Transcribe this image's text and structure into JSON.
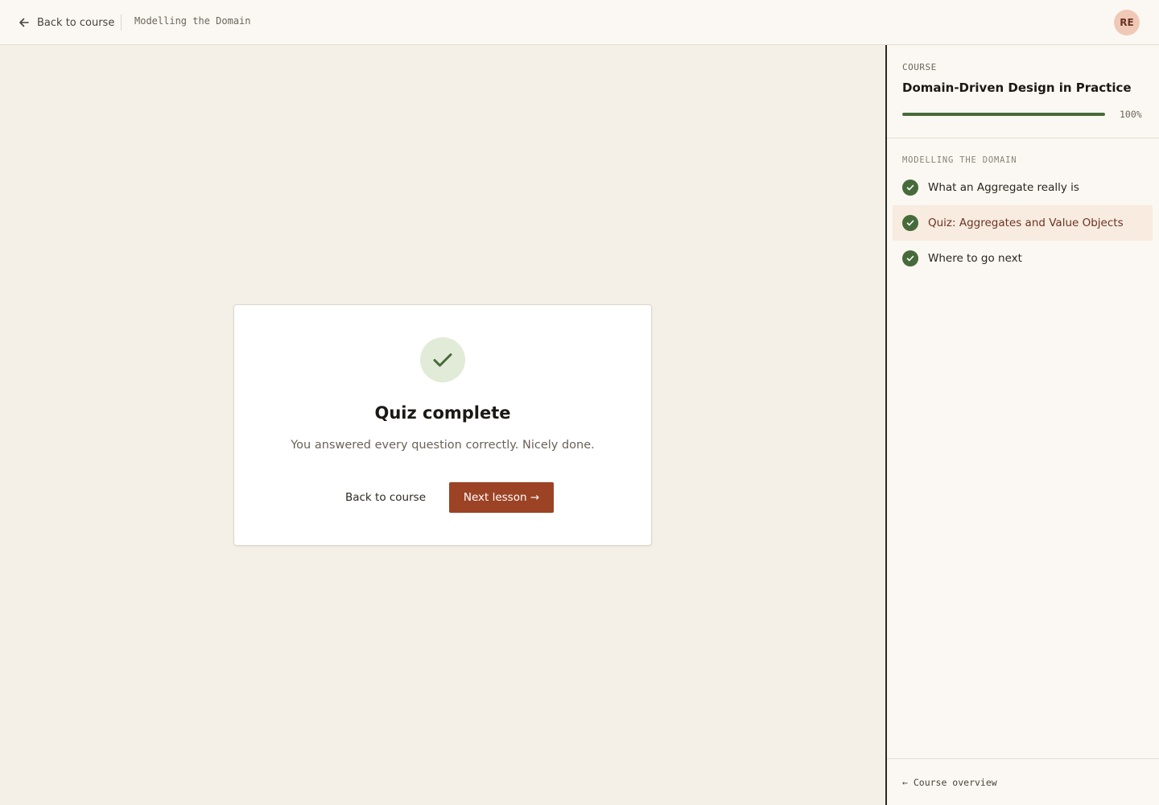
{
  "topbar": {
    "back_label": "Back to course",
    "breadcrumb": "Modelling the Domain",
    "avatar_initials": "RE"
  },
  "card": {
    "title": "Quiz complete",
    "subtitle": "You answered every question correctly. Nicely done.",
    "back_button": "Back to course",
    "next_button": "Next lesson →"
  },
  "sidebar": {
    "label": "COURSE",
    "course_title": "Domain-Driven Design in Practice",
    "progress_percent": 100,
    "progress_text": "100%",
    "section_title": "MODELLING THE DOMAIN",
    "lessons": [
      {
        "label": "What an Aggregate really is",
        "completed": true,
        "active": false
      },
      {
        "label": "Quiz: Aggregates and Value Objects",
        "completed": true,
        "active": true
      },
      {
        "label": "Where to go next",
        "completed": true,
        "active": false
      }
    ],
    "footer_link": "← Course overview"
  },
  "colors": {
    "accent": "#9c4326",
    "success": "#476a3b",
    "background": "#f4f0e8",
    "active_row": "#f8ebdf"
  }
}
